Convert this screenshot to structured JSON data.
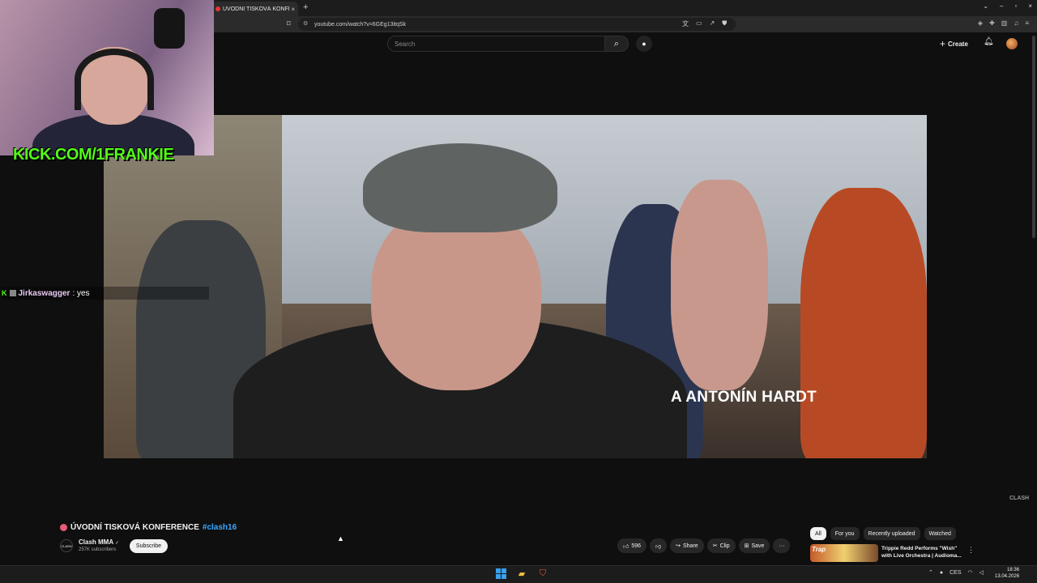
{
  "browser": {
    "tab_title": "ÚVODNÍ TISKOVÁ KONFE",
    "tab_close": "×",
    "new_tab": "+",
    "url": "youtube.com/watch?v=6GEg13itqSk",
    "window_controls": [
      "⌄",
      "–",
      "▫",
      "×"
    ]
  },
  "youtube": {
    "search_placeholder": "Search",
    "create_label": "Create"
  },
  "overlay": {
    "kick_text": "KICK.COM/1FRANKIE",
    "chat": {
      "badge": "K",
      "user": "Jirkaswagger",
      "message": ": yes"
    }
  },
  "video": {
    "caption": "A ANTONÍN HARDT",
    "watermark": "CLASH",
    "title": "ÚVODNÍ TISKOVÁ KONFERENCE",
    "hashtag": "#clash16"
  },
  "channel": {
    "logo_text": "CLASH",
    "name": "Clash MMA",
    "verified": "✓",
    "subscribers": "257K subscribers",
    "subscribe_label": "Subscribe"
  },
  "actions": {
    "likes": "596",
    "share": "Share",
    "clip": "Clip",
    "save": "Save",
    "more": "···"
  },
  "sidebar": {
    "chips": [
      "All",
      "For you",
      "Recently uploaded",
      "Watched"
    ],
    "recommended": {
      "thumb_text": "Trap",
      "title": "Trippie Redd Performs \"Wish\" with Live Orchestra | Audioma..."
    }
  },
  "taskbar": {
    "lang": "CES",
    "time": "18:36",
    "date": "13.04.2026"
  },
  "colors": {
    "kick_green": "#53fc18",
    "hashtag_blue": "#3ea6ff",
    "youtube_bg": "#0f0f0f"
  }
}
